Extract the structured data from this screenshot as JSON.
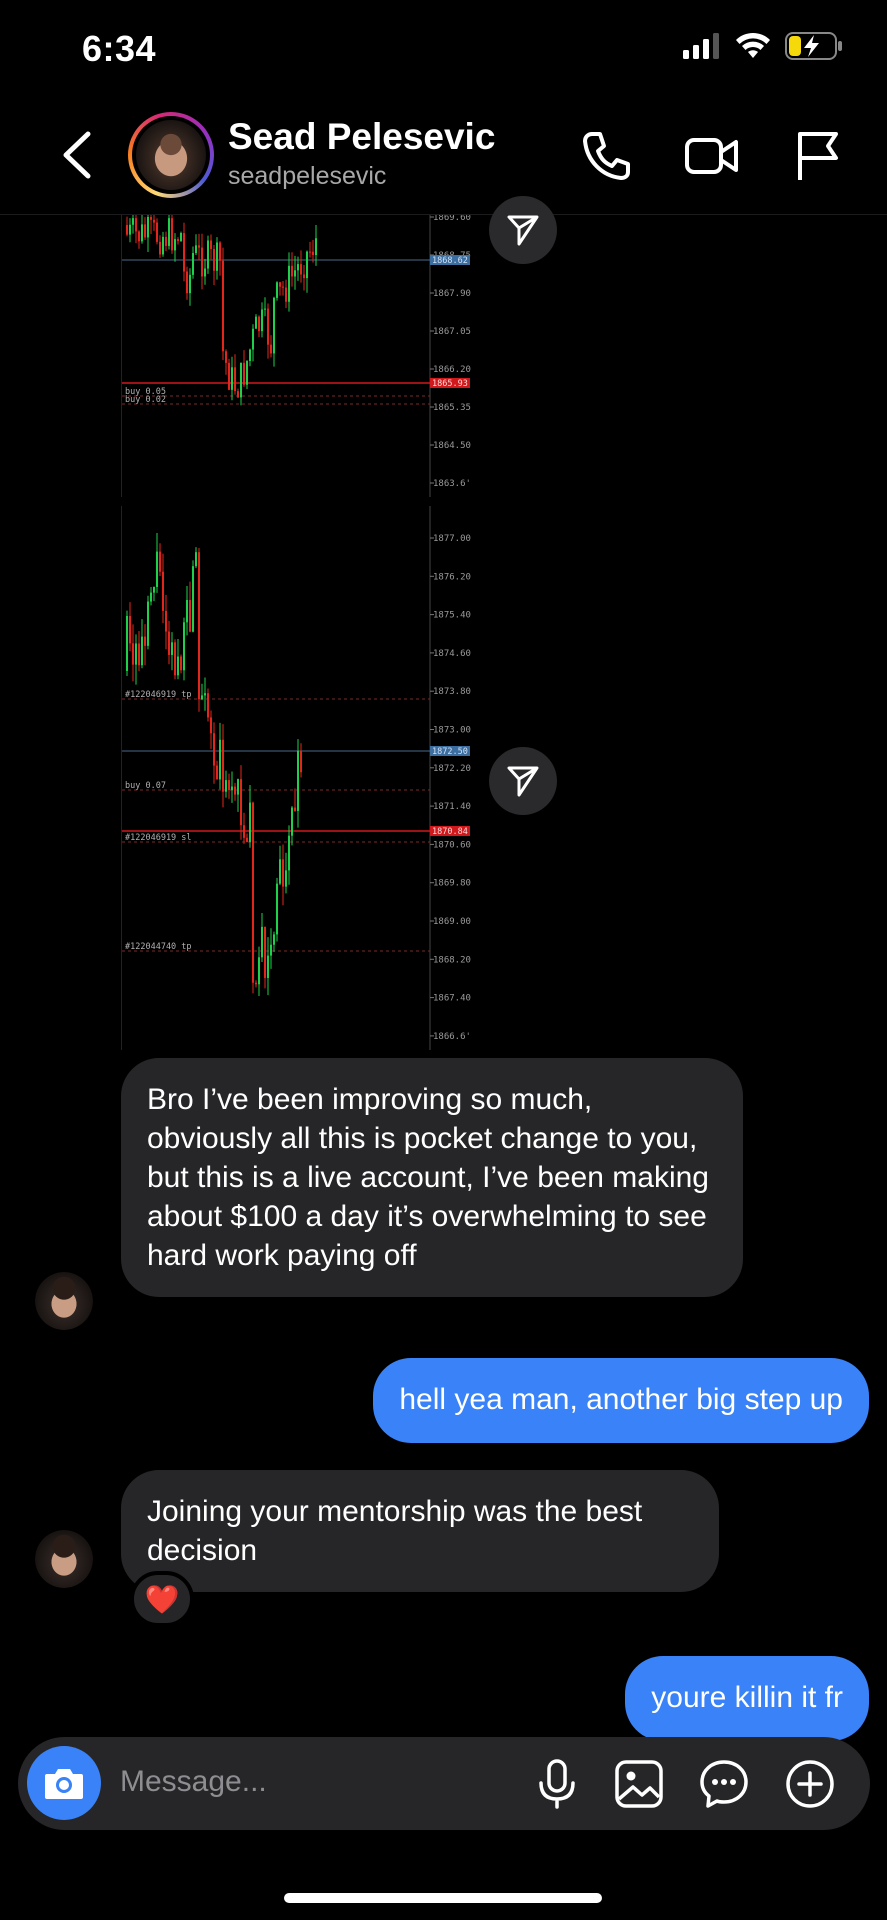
{
  "status_bar": {
    "time": "6:34"
  },
  "header": {
    "display_name": "Sead Pelesevic",
    "username": "seadpelesevic"
  },
  "chart_top": {
    "price_labels": [
      "1869.60",
      "1868.75",
      "1867.90",
      "1867.05",
      "1866.20",
      "1865.35",
      "1864.50",
      "1863.6'"
    ],
    "current_price": "1868.62",
    "line_price": "1865.93",
    "order_labels": [
      "buy 0.05",
      "buy 0.02"
    ]
  },
  "chart_bottom": {
    "price_labels": [
      "1877.00",
      "1876.20",
      "1875.40",
      "1874.60",
      "1873.80",
      "1873.00",
      "1872.20",
      "1871.40",
      "1870.60",
      "1869.80",
      "1869.00",
      "1868.20",
      "1867.40",
      "1866.6'"
    ],
    "current_price": "1872.50",
    "line_price": "1870.84",
    "order_labels": [
      "#122046919 tp",
      "buy 0.07",
      "#122046919 sl",
      "#122044740 tp"
    ]
  },
  "messages": [
    {
      "dir": "in",
      "text": "Bro I’ve been improving so much, obviously all this is pocket change to you, but this is a live account, I’ve been making about $100 a day it’s overwhelming to see hard work paying off"
    },
    {
      "dir": "out",
      "text": "hell yea man, another big step up"
    },
    {
      "dir": "in",
      "text": "Joining your mentorship was the best decision",
      "reaction": "❤️"
    },
    {
      "dir": "out",
      "text": "youre killin it fr"
    }
  ],
  "composer": {
    "placeholder": "Message..."
  },
  "icons": [
    "back-chevron-icon",
    "phone-icon",
    "video-icon",
    "flag-icon",
    "send-icon",
    "camera-icon",
    "microphone-icon",
    "gallery-icon",
    "sticker-icon",
    "plus-icon"
  ]
}
